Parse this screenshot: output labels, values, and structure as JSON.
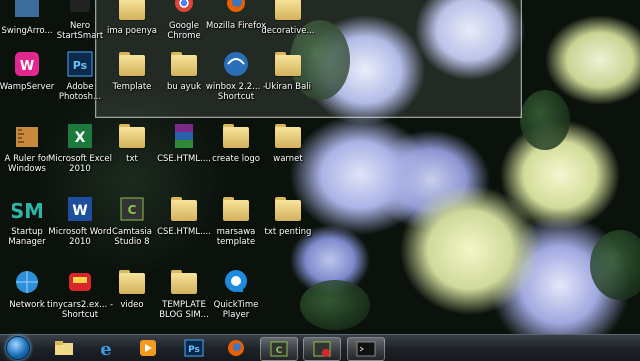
{
  "desktop_icons": [
    {
      "label": "SwingArro...",
      "icon": "app-icon"
    },
    {
      "label": "Nero StartSmart",
      "icon": "nero-icon"
    },
    {
      "label": "ima poenya",
      "icon": "folder-icon"
    },
    {
      "label": "Google Chrome",
      "icon": "chrome-icon"
    },
    {
      "label": "Mozilla Firefox",
      "icon": "firefox-icon"
    },
    {
      "label": "decorative...",
      "icon": "folder-icon"
    },
    {
      "label": "WampServer",
      "icon": "wamp-icon"
    },
    {
      "label": "Adobe Photosh...",
      "icon": "photoshop-icon"
    },
    {
      "label": "Template",
      "icon": "folder-icon"
    },
    {
      "label": "bu ayuk",
      "icon": "folder-icon"
    },
    {
      "label": "winbox 2.2... - Shortcut",
      "icon": "winbox-icon"
    },
    {
      "label": "Ukiran Bali",
      "icon": "folder-icon"
    },
    {
      "label": "A Ruler for Windows",
      "icon": "ruler-icon"
    },
    {
      "label": "Microsoft Excel 2010",
      "icon": "excel-icon"
    },
    {
      "label": "txt",
      "icon": "folder-icon"
    },
    {
      "label": "CSE.HTML....",
      "icon": "winrar-icon"
    },
    {
      "label": "create logo",
      "icon": "folder-icon"
    },
    {
      "label": "warnet",
      "icon": "folder-icon"
    },
    {
      "label": "Startup Manager",
      "icon": "startup-manager-icon"
    },
    {
      "label": "Microsoft Word 2010",
      "icon": "word-icon"
    },
    {
      "label": "Camtasia Studio 8",
      "icon": "camtasia-icon"
    },
    {
      "label": "CSE.HTML....",
      "icon": "folder-icon"
    },
    {
      "label": "marsawa template",
      "icon": "folder-icon"
    },
    {
      "label": "txt penting",
      "icon": "folder-icon"
    },
    {
      "label": "Network",
      "icon": "network-icon"
    },
    {
      "label": "tinycars2.ex... - Shortcut",
      "icon": "tinycars-icon"
    },
    {
      "label": "video",
      "icon": "folder-icon"
    },
    {
      "label": "TEMPLATE BLOG SIM...",
      "icon": "folder-icon"
    },
    {
      "label": "QuickTime Player",
      "icon": "quicktime-icon"
    }
  ],
  "taskbar": {
    "start": "windows-start-orb",
    "pinned": [
      "explorer-icon",
      "ie-icon",
      "media-player-icon",
      "photoshop-icon",
      "firefox-icon",
      "camtasia-icon",
      "camtasia-recorder-icon",
      "cmd-icon"
    ]
  },
  "colors": {
    "taskbar": "#1e2329",
    "label_text": "#ffffff",
    "folder": "#f0d98a"
  }
}
